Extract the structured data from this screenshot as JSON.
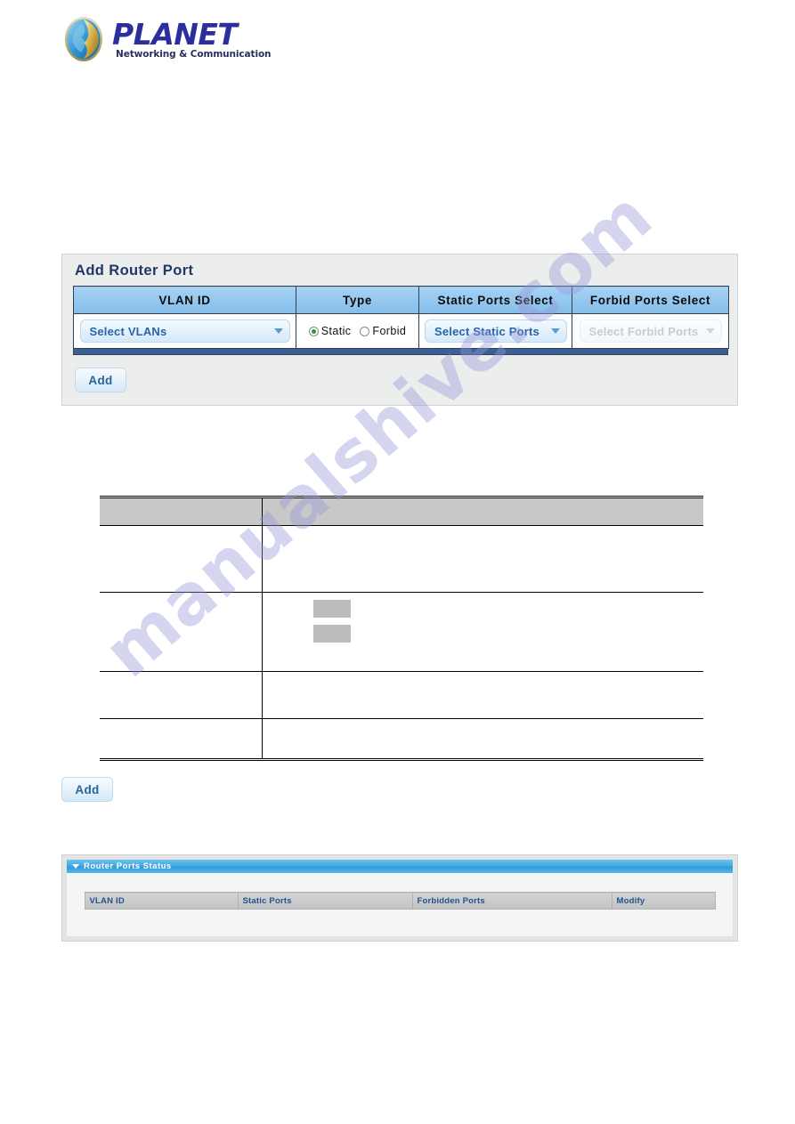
{
  "logo": {
    "brand": "PLANET",
    "tagline": "Networking & Communication",
    "mark": "planet-globe-icon"
  },
  "watermark": {
    "text": "manualshive.com"
  },
  "add_router_port_panel": {
    "title": "Add Router Port",
    "columns": [
      "VLAN ID",
      "Type",
      "Static Ports Select",
      "Forbid Ports Select"
    ],
    "vlan_select": {
      "value": "Select VLANs",
      "enabled": true,
      "arrow_icon": "chevron-down-icon"
    },
    "type_radios": [
      {
        "label": "Static",
        "checked": true
      },
      {
        "label": "Forbid",
        "checked": false
      }
    ],
    "static_ports_select": {
      "value": "Select Static Ports",
      "enabled": true,
      "arrow_icon": "chevron-down-icon"
    },
    "forbid_ports_select": {
      "value": "Select Forbid Ports",
      "enabled": false,
      "arrow_icon": "chevron-down-icon"
    },
    "add_button": "Add"
  },
  "description_table": {
    "headers": [
      "",
      ""
    ],
    "rows": [
      {
        "object": "",
        "description": ""
      },
      {
        "object": "",
        "description": ""
      },
      {
        "object": "",
        "description": ""
      },
      {
        "object": "",
        "description": ""
      }
    ]
  },
  "standalone_add_button": {
    "label": "Add"
  },
  "router_ports_status_panel": {
    "title": "Router Ports Status",
    "collapse_icon": "triangle-down-icon",
    "columns": [
      "VLAN ID",
      "Static Ports",
      "Forbidden Ports",
      "Modify"
    ],
    "rows": []
  },
  "colors": {
    "header_blue": "#8fc4ef",
    "panel_grey": "#eceded",
    "footer_navy": "#3b6098",
    "status_bar_cyan": "#41a7e0",
    "link_blue": "#2a63a8",
    "radio_green": "#1f9b2e",
    "watermark_purple": "#9696d7"
  }
}
